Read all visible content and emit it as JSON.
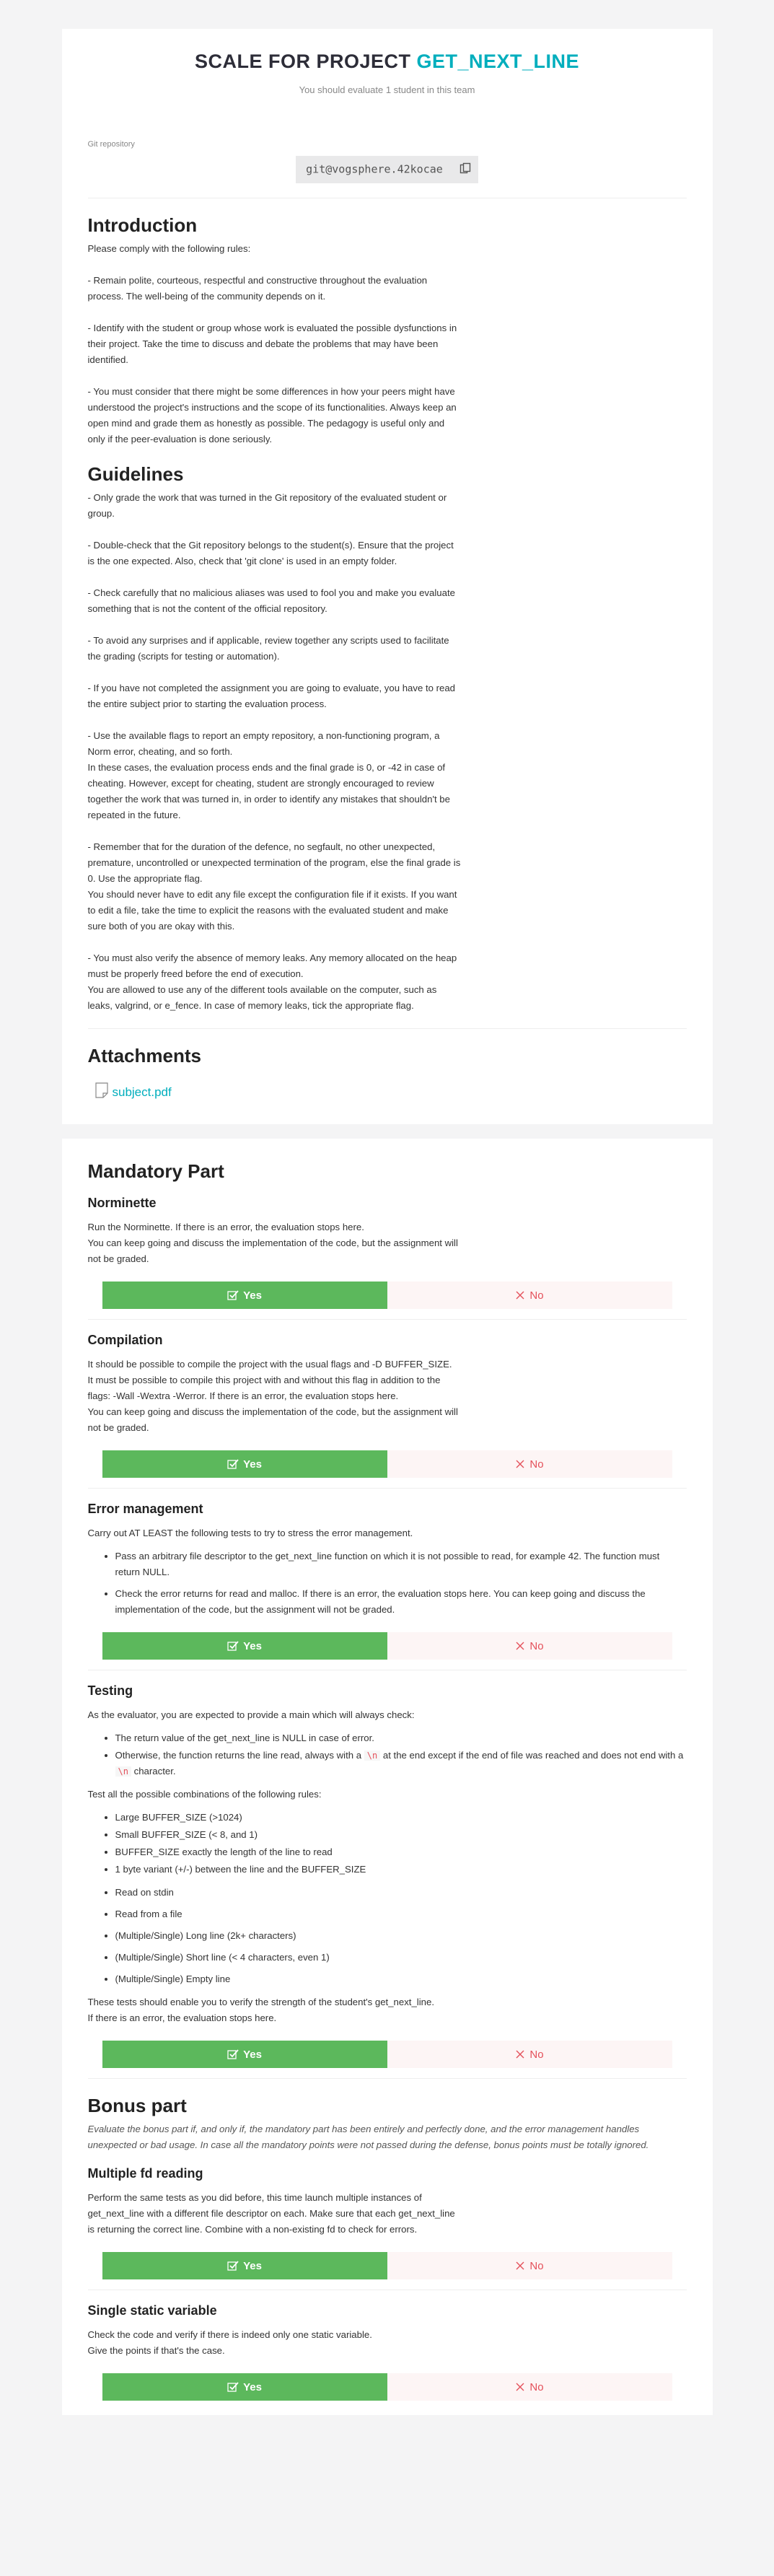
{
  "header": {
    "title_prefix": "SCALE FOR PROJECT",
    "title_project": "GET_NEXT_LINE",
    "subtitle": "You should evaluate 1 student in this team"
  },
  "git": {
    "label": "Git repository",
    "url": "git@vogsphere.42kocae"
  },
  "introduction": {
    "title": "Introduction",
    "text": "Please comply with the following rules:\n\n- Remain polite, courteous, respectful and constructive throughout the evaluation process. The well-being of the community depends on it.\n\n- Identify with the student or group whose work is evaluated the possible dysfunctions in their project. Take the time to discuss and debate the problems that may have been identified.\n\n- You must consider that there might be some differences in how your peers might have understood the project's instructions and the scope of its functionalities. Always keep an open mind and grade them as honestly as possible. The pedagogy is useful only and only if the peer-evaluation is done seriously."
  },
  "guidelines": {
    "title": "Guidelines",
    "text": "- Only grade the work that was turned in the Git repository of the evaluated student or group.\n\n- Double-check that the Git repository belongs to the student(s). Ensure that the project is the one expected. Also, check that 'git clone' is used in an empty folder.\n\n- Check carefully that no malicious aliases was used to fool you and make you evaluate something that is not the content of the official repository.\n\n- To avoid any surprises and if applicable, review together any scripts used to facilitate the grading (scripts for testing or automation).\n\n- If you have not completed the assignment you are going to evaluate, you have to read the entire subject prior to starting the evaluation process.\n\n- Use the available flags to report an empty repository, a non-functioning program, a Norm error, cheating, and so forth.\nIn these cases, the evaluation process ends and the final grade is 0, or -42 in case of cheating. However, except for cheating, student are strongly encouraged to review together the work that was turned in, in order to identify any mistakes that shouldn't be repeated in the future.\n\n- Remember that for the duration of the defence, no segfault, no other unexpected, premature, uncontrolled or unexpected termination of the program, else the final grade is 0. Use the appropriate flag.\nYou should never have to edit any file except the configuration file if it exists. If you want to edit a file, take the time to explicit the reasons with the evaluated student and make sure both of you are okay with this.\n\n- You must also verify the absence of memory leaks. Any memory allocated on the heap must be properly freed before the end of execution.\nYou are allowed to use any of the different tools available on the computer, such as leaks, valgrind, or e_fence. In case of memory leaks, tick the appropriate flag."
  },
  "attachments": {
    "title": "Attachments",
    "file": "subject.pdf"
  },
  "buttons": {
    "yes": "Yes",
    "no": "No"
  },
  "mandatory": {
    "title": "Mandatory Part",
    "norminette": {
      "title": "Norminette",
      "text": "Run the Norminette. If there is an error, the evaluation stops here.\nYou can keep going and discuss the implementation of the code, but the assignment will not be graded."
    },
    "compilation": {
      "title": "Compilation",
      "text": "It should be possible to compile the project with the usual flags and -D BUFFER_SIZE.\nIt must be possible to compile this project with and without this flag in addition to the flags: -Wall -Wextra -Werror. If there is an error, the evaluation stops here.\nYou can keep going and discuss the implementation of the code, but the assignment will not be graded."
    },
    "error_management": {
      "title": "Error management",
      "text": "Carry out AT LEAST the following tests to try to stress the error management.",
      "items": [
        "Pass an arbitrary file descriptor to the get_next_line function on which it is not possible to read, for example 42. The function must return NULL.",
        "Check the error returns for read and malloc. If there is an error, the evaluation stops here. You can keep going and discuss the implementation of the code, but the assignment will not be graded."
      ]
    },
    "testing": {
      "title": "Testing",
      "intro": "As the evaluator, you are expected to provide a main which will always check:",
      "check1": "The return value of the get_next_line is NULL in case of error.",
      "check2_a": "Otherwise, the function returns the line read, always with a ",
      "check2_code1": "\\n",
      "check2_b": " at the end except if the end of file was reached and does not end with a ",
      "check2_code2": "\\n",
      "check2_c": " character.",
      "combos_intro": "Test all the possible combinations of the following rules:",
      "group1": [
        "Large BUFFER_SIZE (>1024)",
        "Small BUFFER_SIZE (< 8, and 1)",
        "BUFFER_SIZE exactly the length of the line to read",
        "1 byte variant (+/-) between the line and the BUFFER_SIZE"
      ],
      "group2": [
        "Read on stdin",
        "Read from a file",
        "(Multiple/Single) Long line (2k+ characters)",
        "(Multiple/Single) Short line (< 4 characters, even 1)",
        "(Multiple/Single) Empty line"
      ],
      "outro": "These tests should enable you to verify the strength of the student's get_next_line.\nIf there is an error, the evaluation stops here."
    }
  },
  "bonus": {
    "title": "Bonus part",
    "intro": "Evaluate the bonus part if, and only if, the mandatory part has been entirely and perfectly done, and the error management handles unexpected or bad usage. In case all the mandatory points were not passed during the defense, bonus points must be totally ignored.",
    "multiple_fd": {
      "title": "Multiple fd reading",
      "text": "Perform the same tests as you did before, this time launch multiple instances of get_next_line with a different file descriptor on each. Make sure that each get_next_line is returning the correct line. Combine with a non-existing fd to check for errors."
    },
    "static_var": {
      "title": "Single static variable",
      "text": "Check the code and verify if there is indeed only one static variable.\nGive the points if that's the case."
    }
  }
}
